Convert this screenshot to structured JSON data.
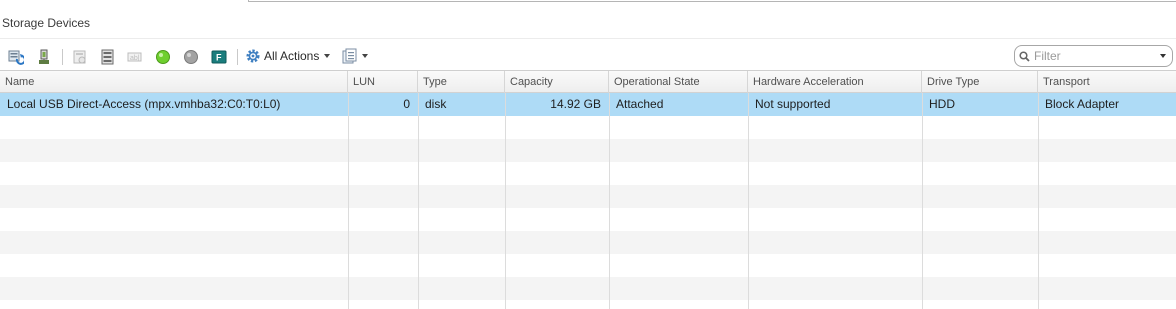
{
  "panel": {
    "title": "Storage Devices"
  },
  "toolbar": {
    "icons": [
      "refresh-icon",
      "attach-storage-icon",
      "detach-icon",
      "rescan-icon",
      "rename-icon",
      "turn-on-led-icon",
      "turn-off-led-icon",
      "mark-flash-icon"
    ],
    "all_actions_label": "All Actions",
    "export_icon": "export-icon"
  },
  "filter": {
    "placeholder": "Filter"
  },
  "table": {
    "columns": [
      "Name",
      "LUN",
      "Type",
      "Capacity",
      "Operational State",
      "Hardware Acceleration",
      "Drive Type",
      "Transport"
    ],
    "rows": [
      {
        "name": "Local USB Direct-Access (mpx.vmhba32:C0:T0:L0)",
        "lun": "0",
        "type": "disk",
        "capacity": "14.92 GB",
        "operational_state": "Attached",
        "hardware_acceleration": "Not supported",
        "drive_type": "HDD",
        "transport": "Block Adapter"
      }
    ]
  },
  "colors": {
    "selected_row": "#aedbf6",
    "led_on": "#6fcf2f",
    "led_off": "#9b9b9b",
    "flash_badge": "#1a7d7d"
  }
}
